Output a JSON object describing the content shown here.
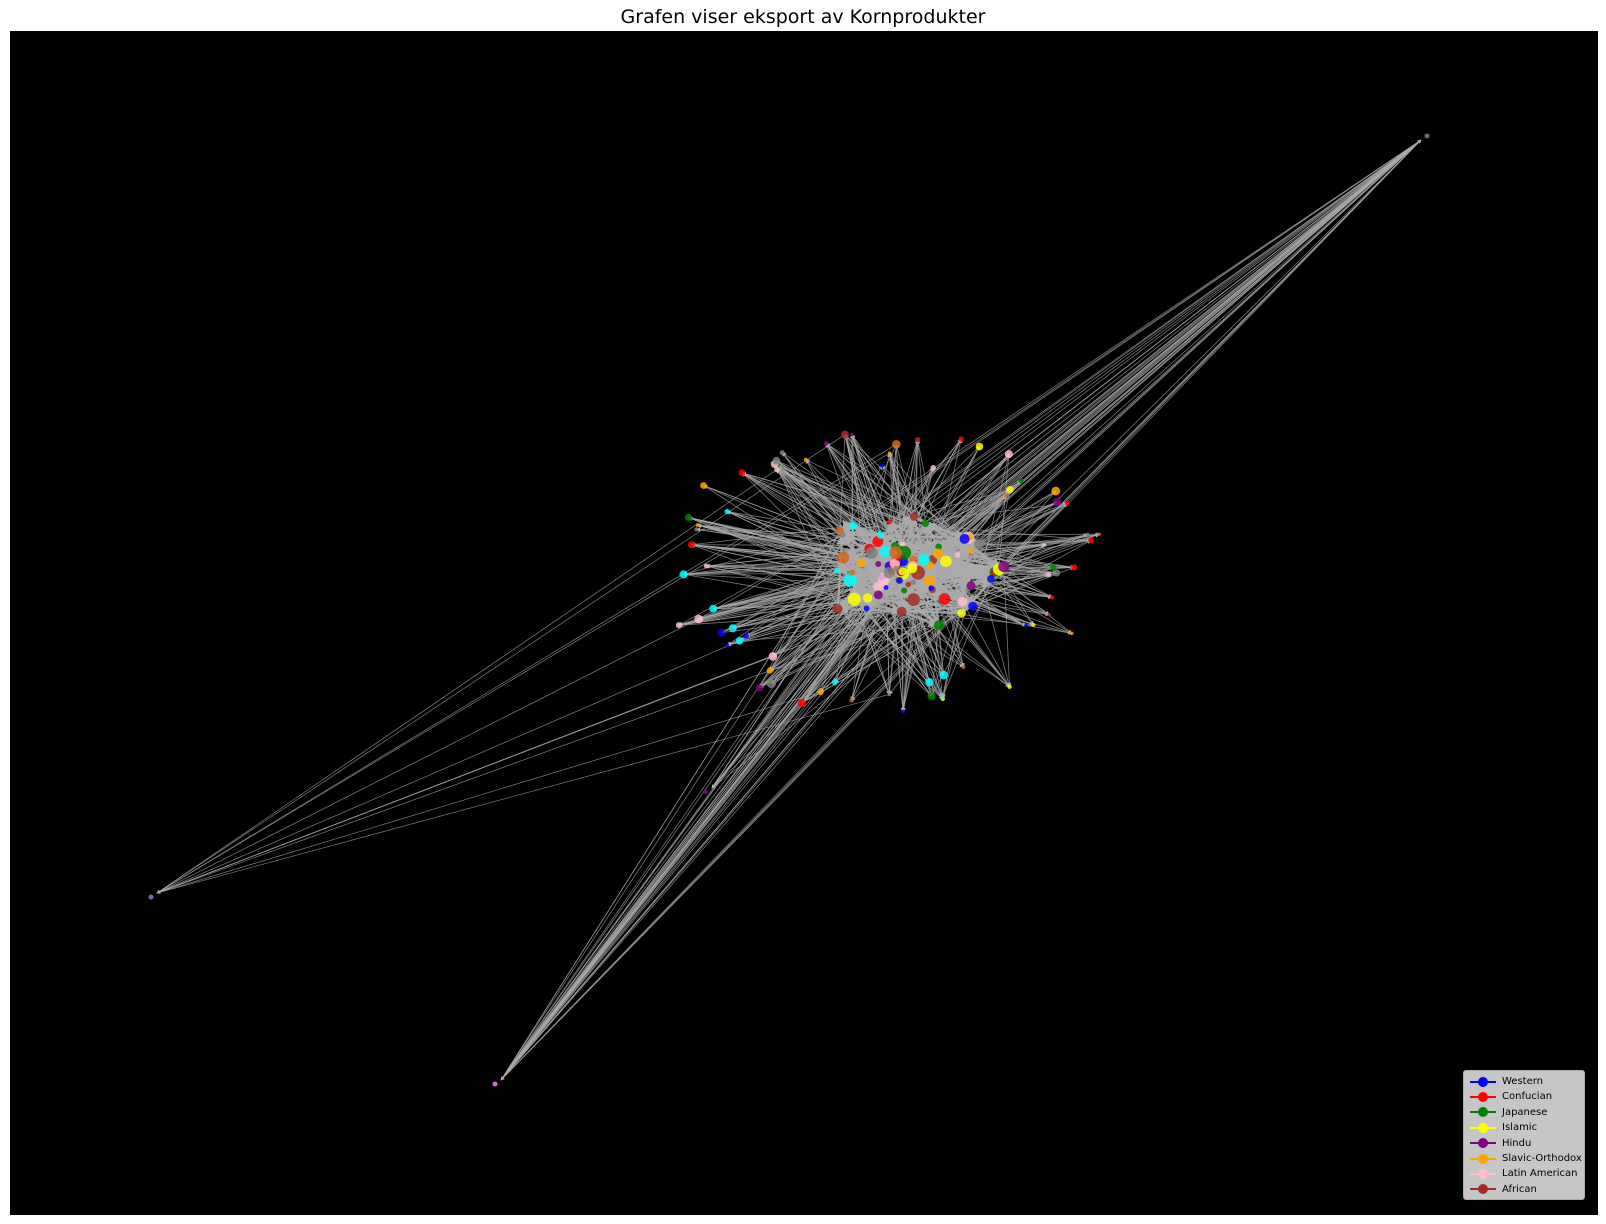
{
  "title": "Grafen viser eksport av Kornprodukter",
  "edge_color": "#aaaaaa",
  "legend": [
    {
      "label": "Western",
      "color": "#0000ff"
    },
    {
      "label": "Confucian",
      "color": "#ff0000"
    },
    {
      "label": "Japanese",
      "color": "#008000"
    },
    {
      "label": "Islamic",
      "color": "#ffff00"
    },
    {
      "label": "Hindu",
      "color": "#800080"
    },
    {
      "label": "Slavic-Orthodox",
      "color": "#ffa500"
    },
    {
      "label": "Latin American",
      "color": "#ffc0cb"
    },
    {
      "label": "African",
      "color": "#a52a2a"
    }
  ]
}
